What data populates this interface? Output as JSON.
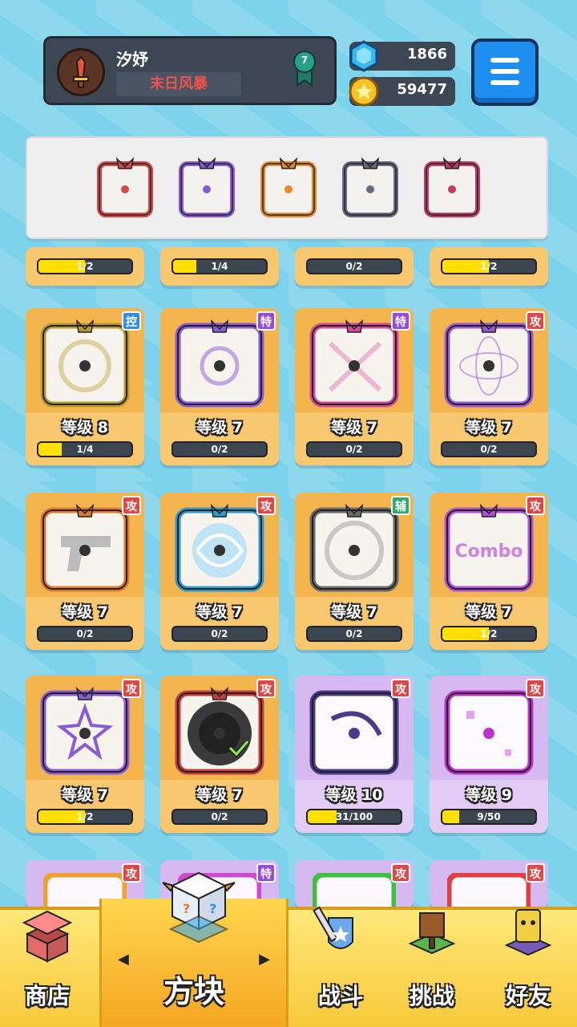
{
  "header": {
    "player_name": "汐妤",
    "player_title": "末日风暴",
    "rank": "7",
    "gems": "1866",
    "coins": "59477"
  },
  "deck": [
    {
      "name": "star-burst-dice",
      "color": "#d84a4a"
    },
    {
      "name": "vortex-dice",
      "color": "#8a5ad8"
    },
    {
      "name": "flame-dice",
      "color": "#e6882e"
    },
    {
      "name": "jaws-dice",
      "color": "#6a6a80"
    },
    {
      "name": "saw-dice",
      "color": "#c23a6a"
    }
  ],
  "partial_row": [
    {
      "progress": "1/2",
      "fill": 0.5
    },
    {
      "progress": "1/4",
      "fill": 0.25
    },
    {
      "progress": "0/2",
      "fill": 0
    },
    {
      "progress": "1/2",
      "fill": 0.5
    }
  ],
  "cards": [
    {
      "tag": "控",
      "tag_color": "blue",
      "level": "等级 8",
      "progress": "1/4",
      "fill": 0.25,
      "theme": "orange",
      "accent": "#b89a2a",
      "icon": "gear-target-icon"
    },
    {
      "tag": "特",
      "tag_color": "purple",
      "level": "等级 7",
      "progress": "0/2",
      "fill": 0,
      "theme": "orange",
      "accent": "#8a5ad8",
      "icon": "spiral-arrows-icon"
    },
    {
      "tag": "特",
      "tag_color": "purple",
      "level": "等级 7",
      "progress": "0/2",
      "fill": 0,
      "theme": "orange",
      "accent": "#d8489a",
      "icon": "syringe-icon"
    },
    {
      "tag": "攻",
      "tag_color": "red",
      "level": "等级 7",
      "progress": "0/2",
      "fill": 0,
      "theme": "orange",
      "accent": "#9a58d8",
      "icon": "orbit-icon"
    },
    {
      "tag": "攻",
      "tag_color": "red",
      "level": "等级 7",
      "progress": "0/2",
      "fill": 0,
      "theme": "orange",
      "accent": "#e07a2a",
      "icon": "gun-icon"
    },
    {
      "tag": "攻",
      "tag_color": "red",
      "level": "等级 7",
      "progress": "0/2",
      "fill": 0,
      "theme": "orange",
      "accent": "#2e9ad0",
      "icon": "whirlpool-icon"
    },
    {
      "tag": "辅",
      "tag_color": "green",
      "level": "等级 7",
      "progress": "0/2",
      "fill": 0,
      "theme": "orange",
      "accent": "#6a6a6a",
      "icon": "clock-icon"
    },
    {
      "tag": "攻",
      "tag_color": "red",
      "level": "等级 7",
      "progress": "1/2",
      "fill": 0.5,
      "theme": "orange",
      "accent": "#b050d8",
      "icon": "combo-icon",
      "combo_text": "Combo"
    },
    {
      "tag": "攻",
      "tag_color": "red",
      "level": "等级 7",
      "progress": "1/2",
      "fill": 0.5,
      "theme": "orange",
      "accent": "#8a5ad8",
      "icon": "star-icon"
    },
    {
      "tag": "攻",
      "tag_color": "red",
      "level": "等级 7",
      "progress": "0/2",
      "fill": 0,
      "theme": "orange",
      "accent": "#c83a3a",
      "icon": "black-hole-icon",
      "equipped": true
    },
    {
      "tag": "攻",
      "tag_color": "red",
      "level": "等级 10",
      "progress": "31/100",
      "fill": 0.31,
      "theme": "purple",
      "accent": "#4a3a8a",
      "icon": "crescent-icon"
    },
    {
      "tag": "攻",
      "tag_color": "red",
      "level": "等级 9",
      "progress": "9/50",
      "fill": 0.18,
      "theme": "purple",
      "accent": "#c030d0",
      "icon": "sparkle-icon"
    }
  ],
  "bottom_row_tags": [
    {
      "tag": "攻",
      "tag_color": "red",
      "accent": "#f0a030"
    },
    {
      "tag": "特",
      "tag_color": "purple",
      "accent": "#d04ad0"
    },
    {
      "tag": "攻",
      "tag_color": "red",
      "accent": "#40c040"
    },
    {
      "tag": "攻",
      "tag_color": "red",
      "accent": "#e04040"
    }
  ],
  "nav": {
    "shop": "商店",
    "blocks": "方块",
    "battle": "战斗",
    "challenge": "挑战",
    "friends": "好友",
    "left_arrow": "◀",
    "right_arrow": "▶"
  }
}
